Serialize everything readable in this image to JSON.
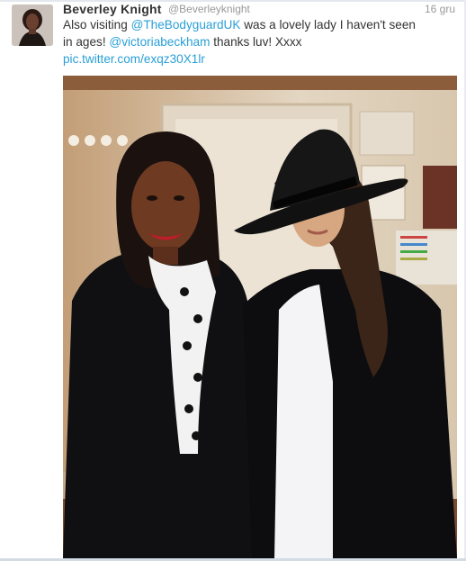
{
  "tweet": {
    "author_name": "Beverley Knight",
    "author_handle": "@Beverleyknight",
    "timestamp": "16 gru",
    "text_parts": [
      {
        "type": "text",
        "value": "Also visiting "
      },
      {
        "type": "mention",
        "value": "@TheBodyguardUK"
      },
      {
        "type": "text",
        "value": " was a lovely lady I haven't seen in ages! "
      },
      {
        "type": "mention",
        "value": "@victoriabeckham"
      },
      {
        "type": "text",
        "value": " thanks luv! Xxxx"
      }
    ],
    "media_link": "pic.twitter.com/exqz30X1lr"
  },
  "colors": {
    "link": "#2a9fd6",
    "name": "#333333",
    "meta": "#999999"
  },
  "icons": {
    "avatar": "profile-photo",
    "photo": "attached-photo"
  }
}
